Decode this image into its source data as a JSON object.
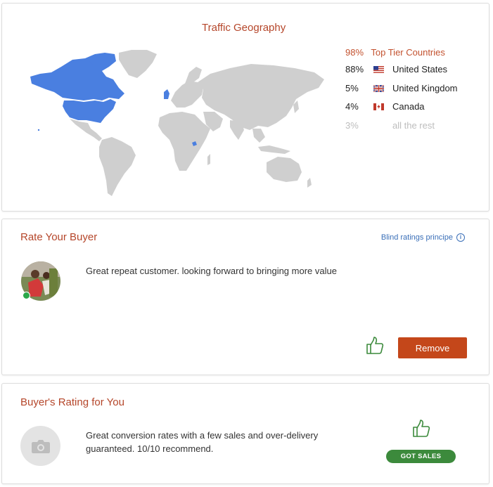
{
  "geography": {
    "title": "Traffic Geography",
    "top_tier": {
      "pct": "98%",
      "label": "Top Tier Countries"
    },
    "countries": [
      {
        "pct": "88%",
        "name": "United States",
        "flag": "us-flag-icon"
      },
      {
        "pct": "5%",
        "name": "United Kingdom",
        "flag": "uk-flag-icon"
      },
      {
        "pct": "4%",
        "name": "Canada",
        "flag": "canada-flag-icon"
      },
      {
        "pct": "3%",
        "name": "all the rest",
        "flag": ""
      }
    ],
    "colors": {
      "highlight": "#4a7fe0",
      "land": "#cfcfcf"
    }
  },
  "rate_buyer": {
    "title": "Rate Your Buyer",
    "blind_link": "Blind ratings principe",
    "review": "Great repeat customer. looking forward to bringing more value",
    "remove_label": "Remove"
  },
  "buyer_rating": {
    "title": "Buyer's Rating for You",
    "review_line1": "Great conversion rates with a few sales and over-delivery",
    "review_line2": "guaranteed. 10/10 recommend.",
    "badge": "GOT SALES"
  },
  "colors": {
    "accent": "#b5462a",
    "remove_button": "#c4471a",
    "badge_green": "#3c8a3c",
    "thumb_green": "#3c8a3c",
    "link_blue": "#3a6fb8"
  }
}
